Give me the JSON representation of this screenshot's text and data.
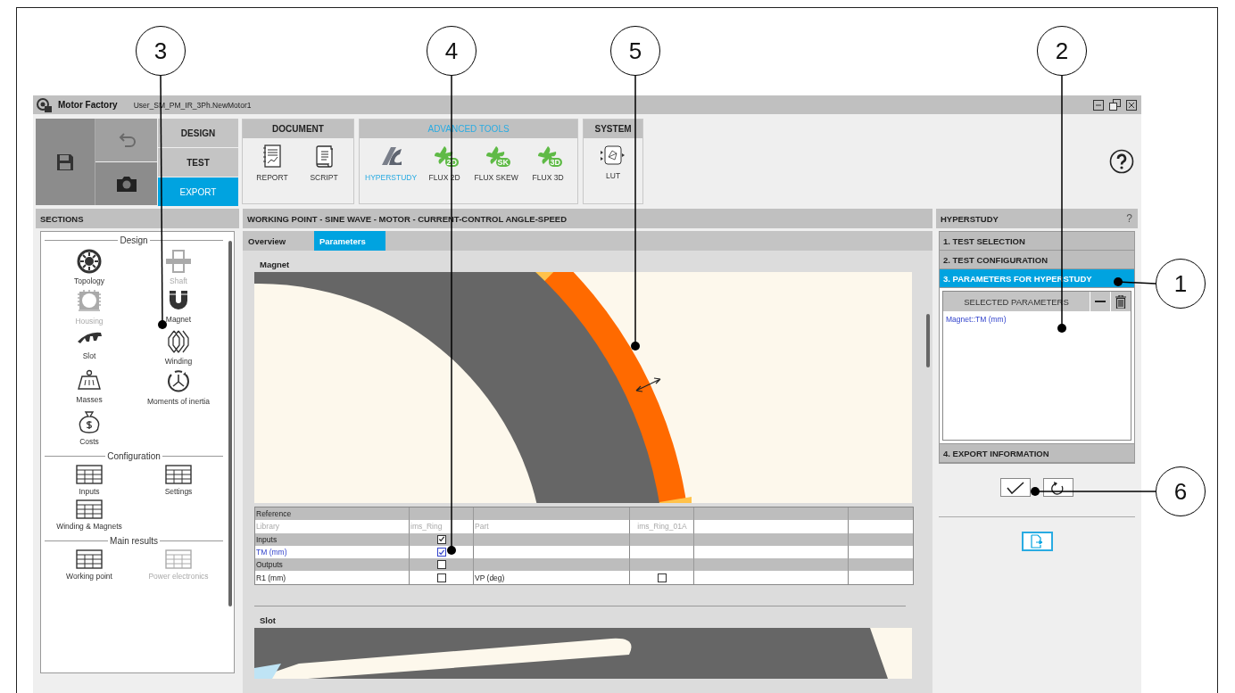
{
  "window": {
    "app_name": "Motor Factory",
    "file_name": "User_SM_PM_IR_3Ph.NewMotor1"
  },
  "modes": [
    {
      "label": "DESIGN",
      "selected": false
    },
    {
      "label": "TEST",
      "selected": false
    },
    {
      "label": "EXPORT",
      "selected": true
    }
  ],
  "toolbar_groups": [
    {
      "title": "DOCUMENT",
      "highlighted": false,
      "tools": [
        {
          "label": "REPORT",
          "kind": "report",
          "selected": false
        },
        {
          "label": "SCRIPT",
          "kind": "script",
          "selected": false
        }
      ]
    },
    {
      "title": "ADVANCED TOOLS",
      "highlighted": true,
      "tools": [
        {
          "label": "HYPERSTUDY",
          "kind": "hyperstudy",
          "selected": true
        },
        {
          "label": "FLUX 2D",
          "kind": "flux",
          "badge": "2D",
          "selected": false
        },
        {
          "label": "FLUX SKEW",
          "kind": "flux",
          "badge": "SK",
          "selected": false
        },
        {
          "label": "FLUX 3D",
          "kind": "flux",
          "badge": "3D",
          "selected": false
        }
      ]
    },
    {
      "title": "SYSTEM",
      "highlighted": false,
      "tools": [
        {
          "label": "LUT",
          "kind": "lut",
          "selected": false
        }
      ]
    }
  ],
  "sections": {
    "title": "SECTIONS",
    "groups": [
      {
        "title": "Design",
        "items": [
          {
            "label": "Topology",
            "kind": "topology",
            "disabled": false
          },
          {
            "label": "Shaft",
            "kind": "shaft",
            "disabled": true
          },
          {
            "label": "Housing",
            "kind": "housing",
            "disabled": true
          },
          {
            "label": "Magnet",
            "kind": "magnet",
            "disabled": false
          },
          {
            "label": "Slot",
            "kind": "slot",
            "disabled": false
          },
          {
            "label": "Winding",
            "kind": "winding",
            "disabled": false
          },
          {
            "label": "Masses",
            "kind": "masses",
            "disabled": false
          },
          {
            "label": "Moments of inertia",
            "kind": "inertia",
            "disabled": false
          },
          {
            "label": "Costs",
            "kind": "costs",
            "disabled": false
          }
        ]
      },
      {
        "title": "Configuration",
        "items": [
          {
            "label": "Inputs",
            "kind": "table",
            "disabled": false
          },
          {
            "label": "Settings",
            "kind": "table",
            "disabled": false
          },
          {
            "label": "Winding & Magnets",
            "kind": "table",
            "disabled": false
          }
        ]
      },
      {
        "title": "Main results",
        "items": [
          {
            "label": "Working point",
            "kind": "table",
            "disabled": false
          },
          {
            "label": "Power electronics",
            "kind": "table",
            "disabled": true
          }
        ]
      }
    ]
  },
  "main": {
    "title": "WORKING POINT - SINE WAVE - MOTOR - CURRENT-CONTROL ANGLE-SPEED",
    "tabs": [
      {
        "label": "Overview",
        "selected": false
      },
      {
        "label": "Parameters",
        "selected": true
      }
    ],
    "magnet_title": "Magnet",
    "slot_title": "Slot",
    "table": {
      "rows": [
        {
          "kind": "section",
          "cells": [
            {
              "text": "Reference"
            }
          ]
        },
        {
          "kind": "muted",
          "cells": [
            {
              "text": "Library"
            },
            {
              "text": "ims_Ring"
            },
            {
              "text": "Part"
            },
            {
              "text": "ims_Ring_01A"
            }
          ]
        },
        {
          "kind": "section",
          "cells": [
            {
              "text": "Inputs"
            },
            {
              "checked": true
            }
          ]
        },
        {
          "kind": "link",
          "cells": [
            {
              "text": "TM (mm)"
            },
            {
              "checked": true
            }
          ]
        },
        {
          "kind": "section",
          "cells": [
            {
              "text": "Outputs"
            },
            {
              "checked": false
            }
          ]
        },
        {
          "kind": "plain",
          "cells": [
            {
              "text": "R1 (mm)"
            },
            {
              "checked": false
            },
            {
              "text": "VP (deg)"
            },
            {
              "checked": false
            }
          ]
        }
      ]
    }
  },
  "hyperstudy": {
    "title": "HYPERSTUDY",
    "help": "?",
    "steps": [
      {
        "label": "1. TEST SELECTION",
        "selected": false
      },
      {
        "label": "2. TEST CONFIGURATION",
        "selected": false
      },
      {
        "label": "3. PARAMETERS FOR HYPERSTUDY",
        "selected": true
      },
      {
        "label": "4. EXPORT INFORMATION",
        "selected": false
      }
    ],
    "selected_parameters": {
      "header": "SELECTED PARAMETERS",
      "items": [
        "Magnet::TM (mm)"
      ]
    }
  },
  "callouts": [
    {
      "number": "3"
    },
    {
      "number": "4"
    },
    {
      "number": "5"
    },
    {
      "number": "2"
    },
    {
      "number": "1"
    },
    {
      "number": "6"
    }
  ]
}
